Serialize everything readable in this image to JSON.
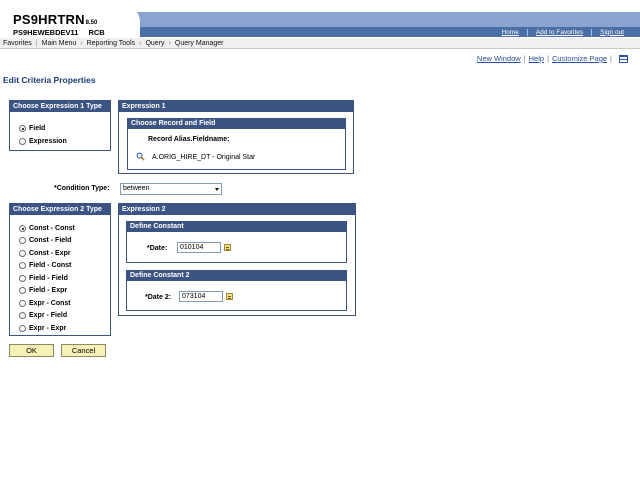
{
  "header": {
    "system": "PS9HRTRN",
    "version": "8.50",
    "database": "PS9HEWEBDEV11",
    "user": "RCB",
    "links": [
      "Home",
      "Add to Favorites",
      "Sign out"
    ]
  },
  "menu": {
    "favorites": "Favorites",
    "main_menu": "Main Menu",
    "reporting_tools": "Reporting Tools",
    "query": "Query",
    "query_manager": "Query Manager"
  },
  "page_links": {
    "new_window": "New Window",
    "help": "Help",
    "customize_page": "Customize Page"
  },
  "title": "Edit Criteria Properties",
  "expr1_type": {
    "caption": "Choose Expression 1 Type",
    "options": [
      {
        "label": "Field",
        "selected": true
      },
      {
        "label": "Expression",
        "selected": false
      }
    ]
  },
  "expr1": {
    "caption": "Expression 1",
    "record_caption": "Choose Record and Field",
    "field_label": "Record Alias.Fieldname:",
    "field_value": "A.ORIG_HIRE_DT - Original Star"
  },
  "condition": {
    "label": "*Condition Type:",
    "value": "between"
  },
  "expr2_type": {
    "caption": "Choose Expression 2 Type",
    "options": [
      {
        "label": "Const - Const",
        "selected": true
      },
      {
        "label": "Const - Field",
        "selected": false
      },
      {
        "label": "Const - Expr",
        "selected": false
      },
      {
        "label": "Field - Const",
        "selected": false
      },
      {
        "label": "Field - Field",
        "selected": false
      },
      {
        "label": "Field - Expr",
        "selected": false
      },
      {
        "label": "Expr - Const",
        "selected": false
      },
      {
        "label": "Expr - Field",
        "selected": false
      },
      {
        "label": "Expr - Expr",
        "selected": false
      }
    ]
  },
  "expr2": {
    "caption": "Expression 2",
    "const1_caption": "Define Constant",
    "date_label": "*Date:",
    "date_value": "010104",
    "const2_caption": "Define Constant 2",
    "date2_label": "*Date 2:",
    "date2_value": "073104"
  },
  "buttons": {
    "ok": "OK",
    "cancel": "Cancel"
  },
  "colors": {
    "caption_bg": "#3c5484",
    "header_light": "#8aa3cf",
    "header_dark": "#4a6fa6",
    "button_bg": "#f6f1b6",
    "link": "#2850a6"
  }
}
